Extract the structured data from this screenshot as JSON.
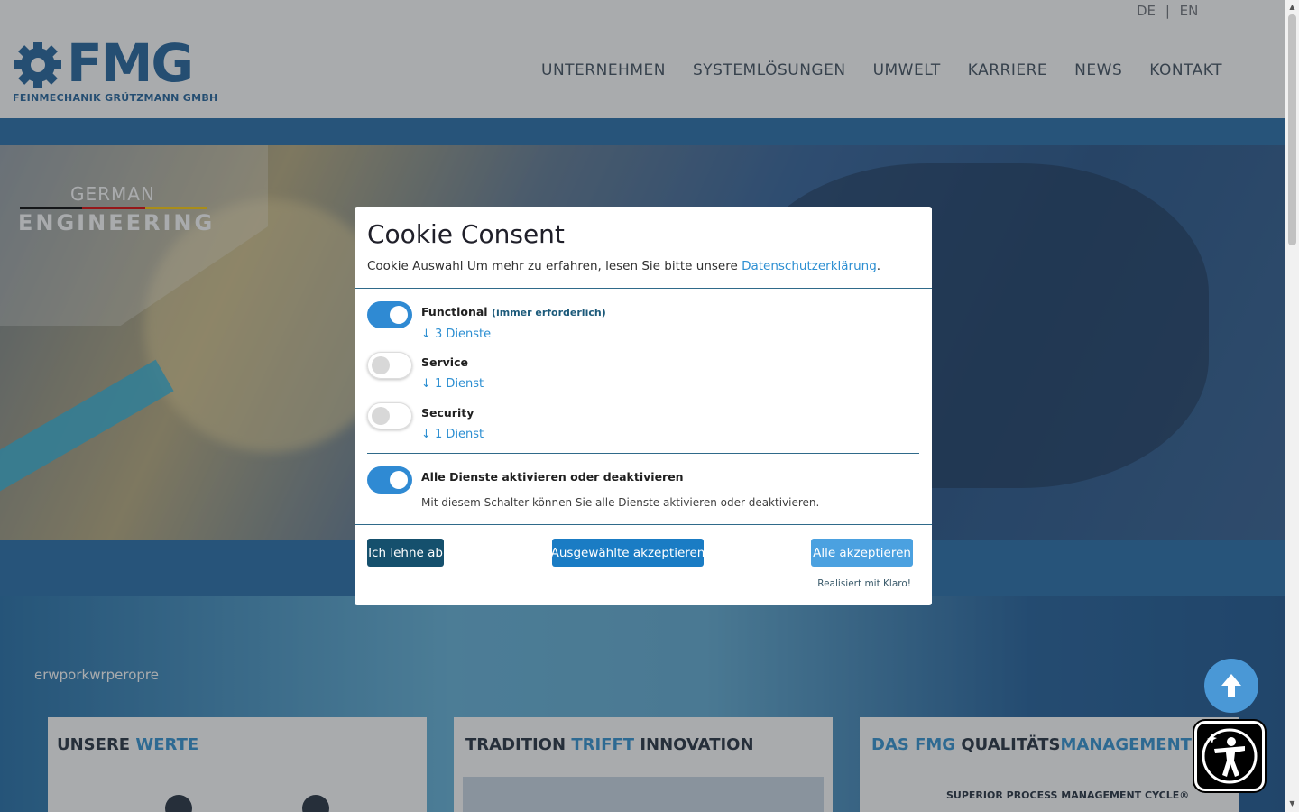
{
  "header": {
    "languages": [
      "DE",
      "EN"
    ],
    "lang_separator": "|",
    "logo": {
      "text": "FMG",
      "subtitle": "FEINMECHANIK GRÜTZMANN GMBH"
    },
    "nav": [
      "UNTERNEHMEN",
      "SYSTEMLÖSUNGEN",
      "UMWELT",
      "KARRIERE",
      "NEWS",
      "KONTAKT"
    ]
  },
  "hero": {
    "badge_line1": "GERMAN",
    "badge_line2": "ENGINEERING"
  },
  "section2": {
    "text": "erwporkwrperopre",
    "cards": [
      {
        "title_a": "UNSERE ",
        "title_b": "WERTE",
        "title_c": ""
      },
      {
        "title_a": "TRADITION ",
        "title_b": "TRIFFT",
        "title_c": " INNOVATION"
      },
      {
        "title_a": "DAS FMG ",
        "title_b": "QUALITÄTS",
        "title_c": "MANAGEMENT",
        "graphic_text": "SUPERIOR PROCESS MANAGEMENT CYCLE®"
      }
    ]
  },
  "cookie_modal": {
    "title": "Cookie Consent",
    "description_prefix": "Cookie Auswahl Um mehr zu erfahren, lesen Sie bitte unsere ",
    "privacy_link": "Datenschutzerklärung",
    "description_suffix": ".",
    "services": [
      {
        "name": "Functional",
        "required_note": "(immer erforderlich)",
        "count": "↓ 3 Dienste",
        "enabled": true
      },
      {
        "name": "Service",
        "required_note": "",
        "count": "↓ 1 Dienst",
        "enabled": false
      },
      {
        "name": "Security",
        "required_note": "",
        "count": "↓ 1 Dienst",
        "enabled": false
      }
    ],
    "toggle_all": {
      "label": "Alle Dienste aktivieren oder deaktivieren",
      "help": "Mit diesem Schalter können Sie alle Dienste aktivieren oder deaktivieren.",
      "enabled": true
    },
    "buttons": {
      "decline": "Ich lehne ab",
      "accept_selected": "Ausgewählte akzeptieren",
      "accept_all": "Alle akzeptieren"
    },
    "powered_by": "Realisiert mit Klaro!"
  },
  "colors": {
    "brand_blue": "#1d5f9a",
    "accent": "#2f8ad3",
    "decline_button": "#15506d"
  },
  "icons": {
    "scroll_top": "arrow-up-icon",
    "accessibility": "accessibility-icon"
  }
}
